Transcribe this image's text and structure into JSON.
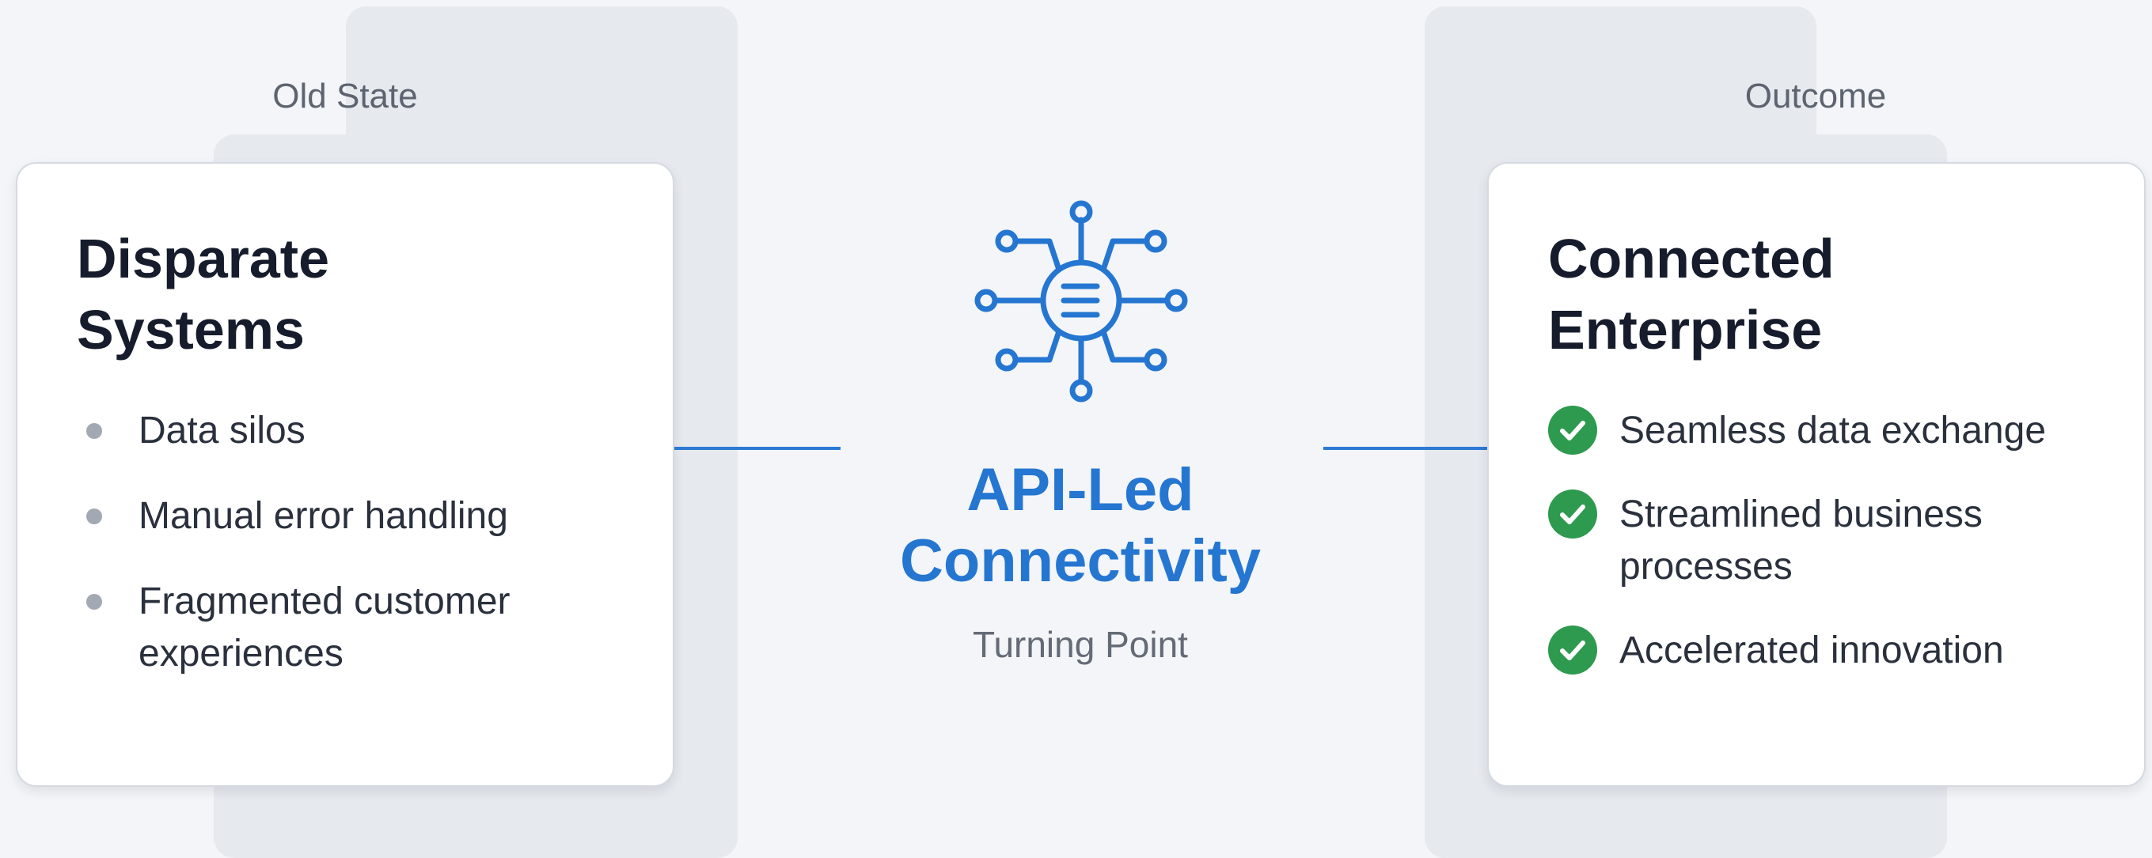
{
  "left_column": {
    "label": "Old State",
    "title": "Disparate Systems",
    "items": [
      "Data silos",
      "Manual error handling",
      "Fragmented customer experiences"
    ]
  },
  "center": {
    "icon": "api-hub-icon",
    "title": "API-Led Connectivity",
    "subtitle": "Turning Point"
  },
  "right_column": {
    "label": "Outcome",
    "title": "Connected Enterprise",
    "items": [
      "Seamless data exchange",
      "Streamlined business processes",
      "Accelerated innovation"
    ]
  },
  "colors": {
    "accent": "#2576d1",
    "check": "#2e9a4f",
    "bullet": "#a3a9b3",
    "background": "#f3f5f8"
  }
}
